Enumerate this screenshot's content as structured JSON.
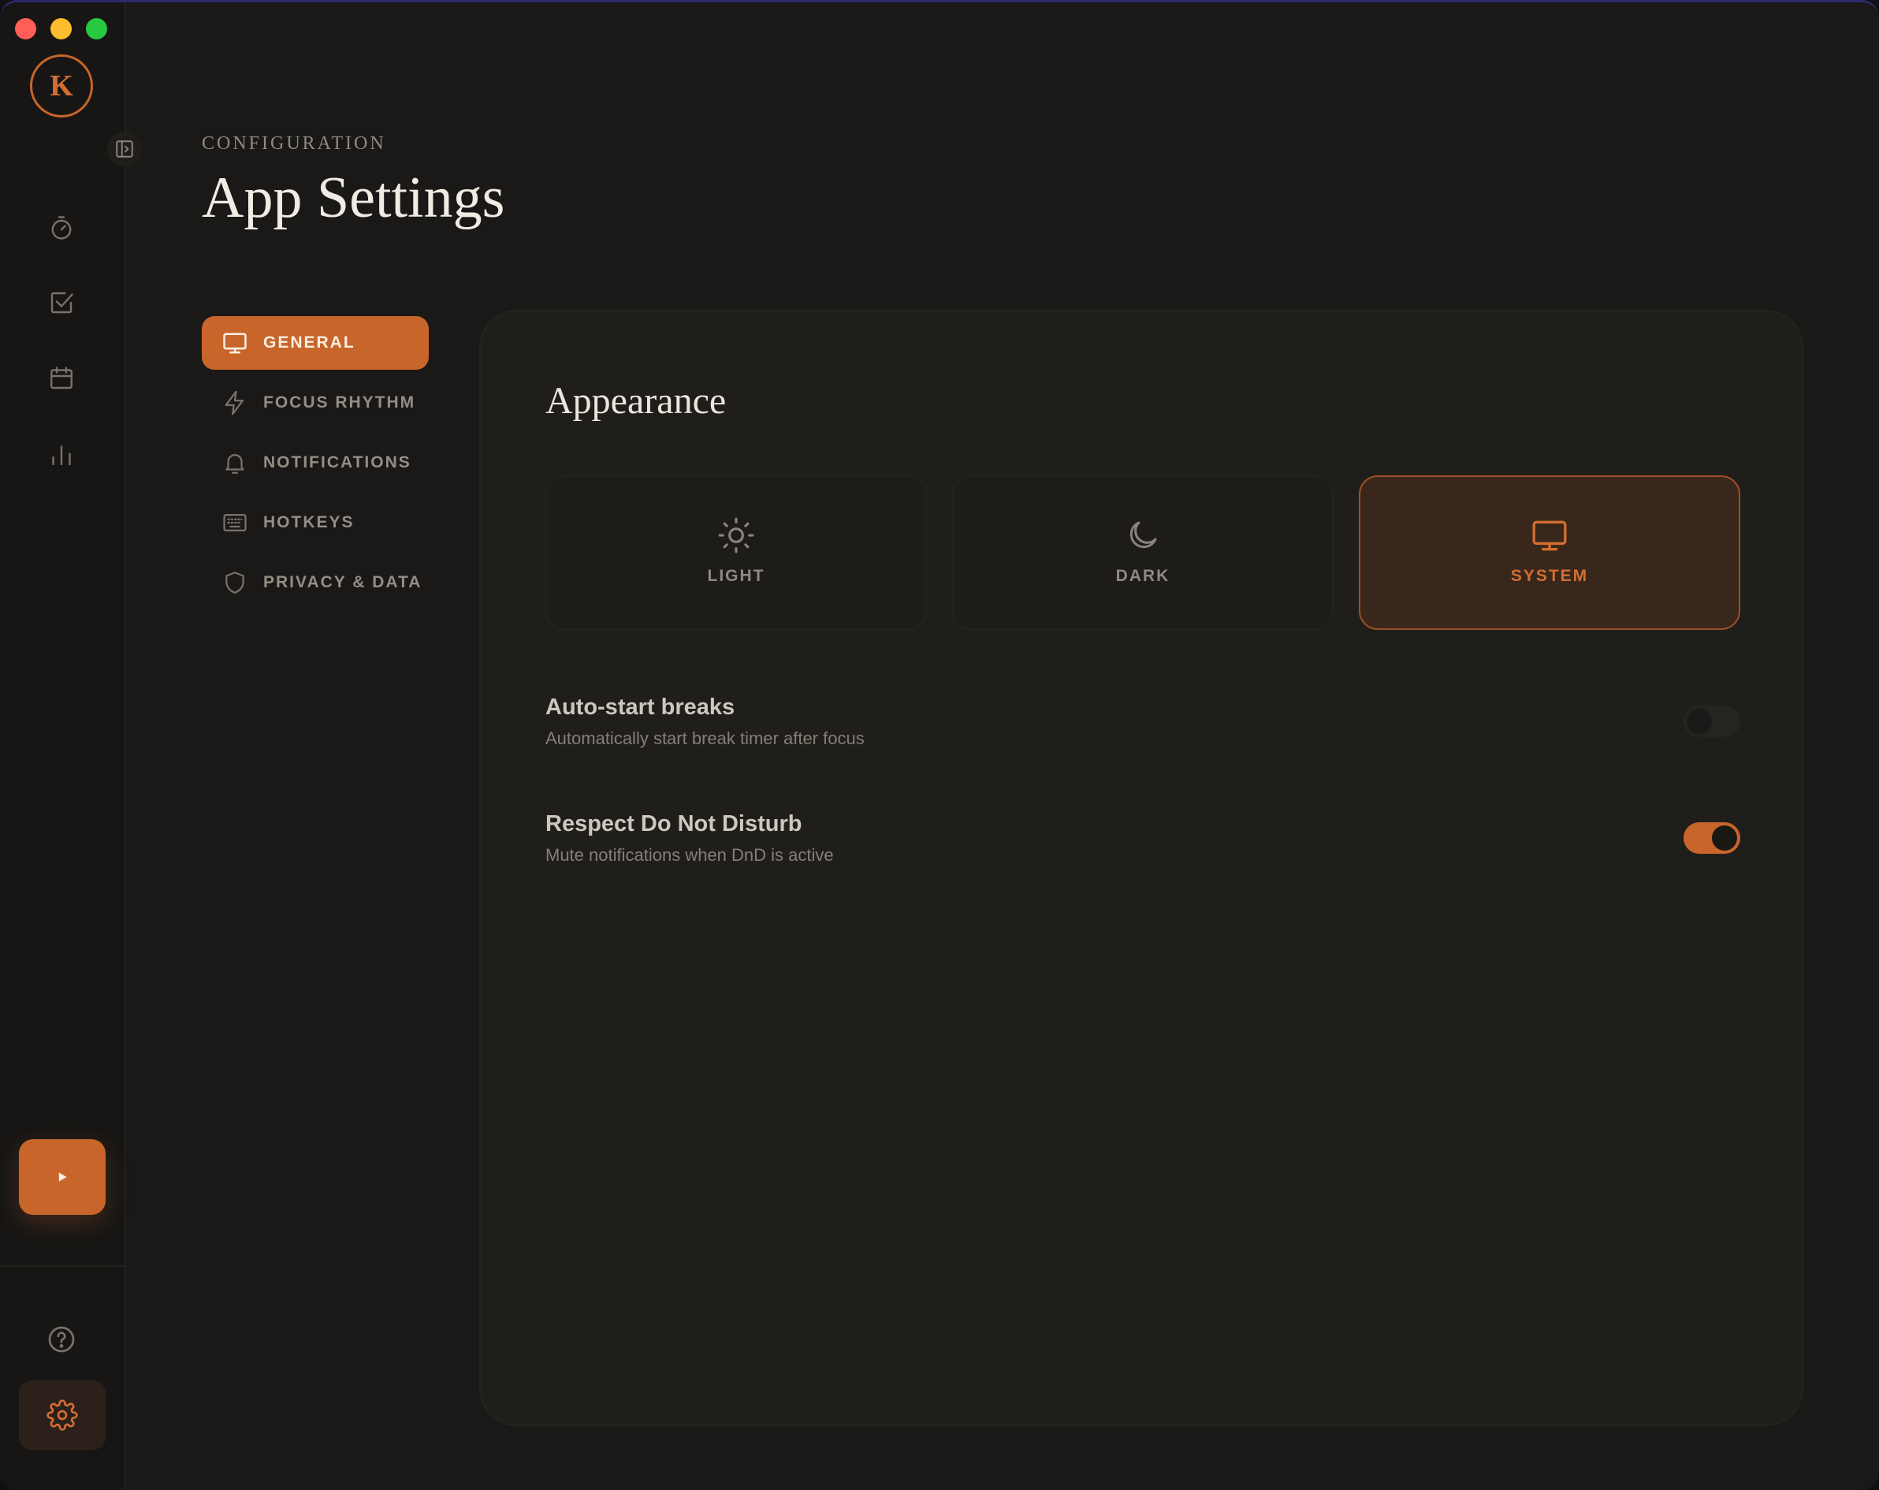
{
  "app": {
    "logo_letter": "K",
    "accent_color": "#c8652b"
  },
  "rail": {
    "items": [
      {
        "icon": "timer-icon"
      },
      {
        "icon": "checklist-icon"
      },
      {
        "icon": "calendar-icon"
      },
      {
        "icon": "stats-icon"
      }
    ],
    "play_icon": "play-icon",
    "help_icon": "help-icon",
    "settings_icon": "gear-icon"
  },
  "header": {
    "eyebrow": "CONFIGURATION",
    "title": "App Settings"
  },
  "nav": {
    "items": [
      {
        "label": "GENERAL",
        "icon": "monitor-icon",
        "active": true
      },
      {
        "label": "FOCUS RHYTHM",
        "icon": "lightning-icon",
        "active": false
      },
      {
        "label": "NOTIFICATIONS",
        "icon": "bell-icon",
        "active": false
      },
      {
        "label": "HOTKEYS",
        "icon": "keyboard-icon",
        "active": false
      },
      {
        "label": "PRIVACY & DATA",
        "icon": "shield-icon",
        "active": false
      }
    ]
  },
  "appearance": {
    "title": "Appearance",
    "options": [
      {
        "label": "LIGHT",
        "icon": "sun-icon",
        "selected": false
      },
      {
        "label": "DARK",
        "icon": "moon-icon",
        "selected": false
      },
      {
        "label": "SYSTEM",
        "icon": "monitor-icon",
        "selected": true
      }
    ]
  },
  "settings": [
    {
      "title": "Auto-start breaks",
      "description": "Automatically start break timer after focus",
      "enabled": false
    },
    {
      "title": "Respect Do Not Disturb",
      "description": "Mute notifications when DnD is active",
      "enabled": true
    }
  ]
}
